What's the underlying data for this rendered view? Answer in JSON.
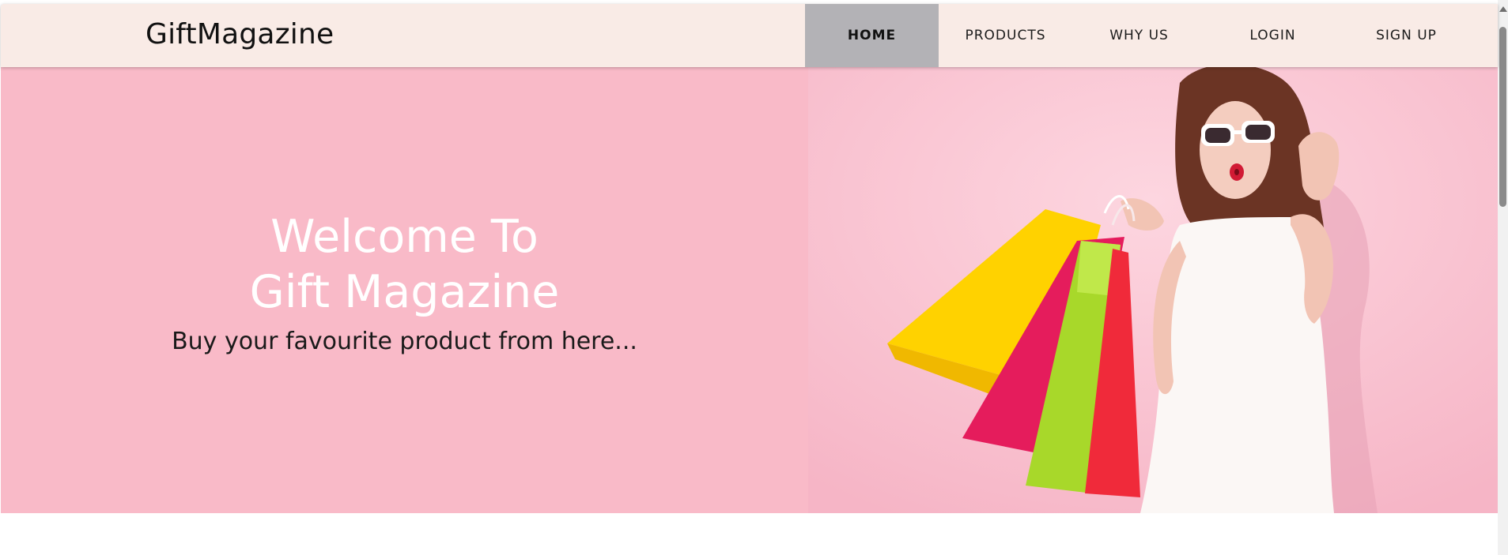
{
  "header": {
    "brand": "GiftMagazine",
    "nav": [
      {
        "label": "HOME",
        "active": true
      },
      {
        "label": "PRODUCTS",
        "active": false
      },
      {
        "label": "WHY US",
        "active": false
      },
      {
        "label": "LOGIN",
        "active": false
      },
      {
        "label": "SIGN UP",
        "active": false
      }
    ]
  },
  "hero": {
    "title_line1": "Welcome To",
    "title_line2": "Gift Magazine",
    "subtitle": "Buy your favourite product from here..."
  },
  "colors": {
    "navbar_bg": "#f9ebe6",
    "nav_active_bg": "#b3b2b6",
    "hero_bg": "#f9bac8",
    "photo_bg": "#fcd0dc"
  },
  "icons": {
    "scroll_up": "scroll-up-arrow-icon"
  }
}
